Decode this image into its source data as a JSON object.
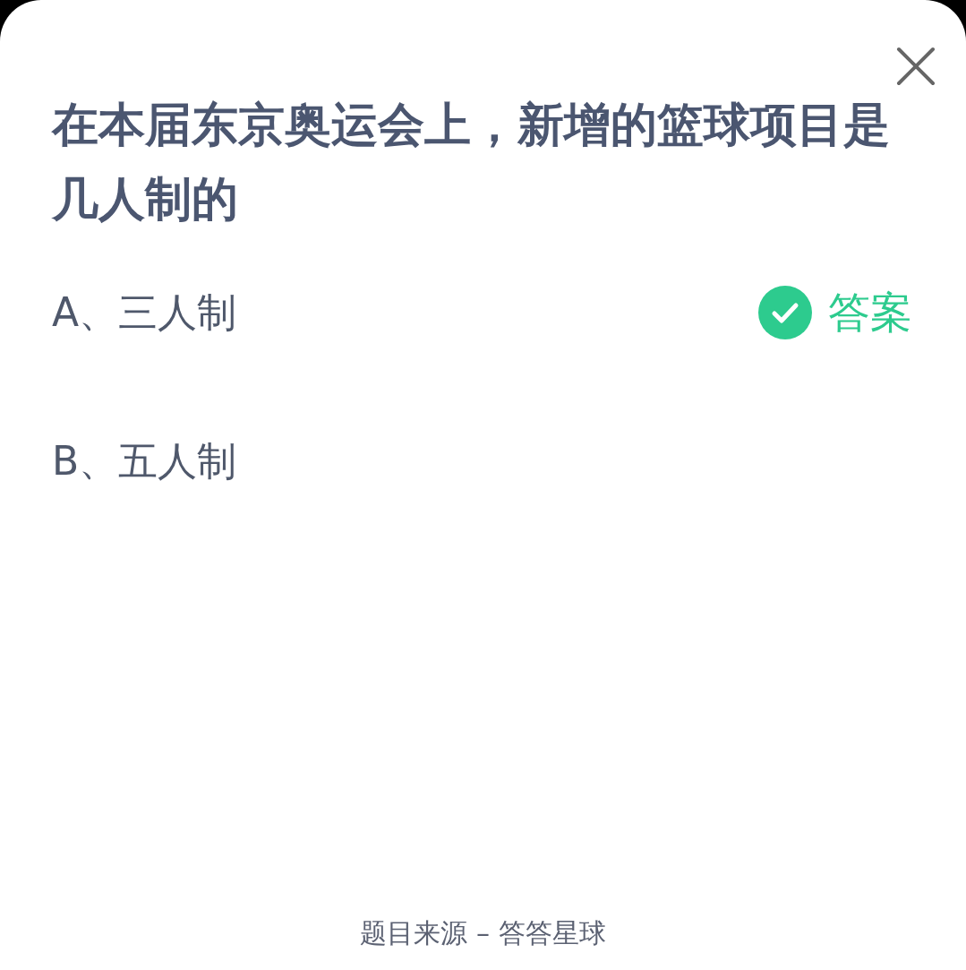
{
  "question": "在本届东京奥运会上，新增的篮球项目是几人制的",
  "options": [
    {
      "label": "A、三人制",
      "correct": true
    },
    {
      "label": "B、五人制",
      "correct": false
    }
  ],
  "answer_badge": "答案",
  "footer": "题目来源 – 答答星球"
}
